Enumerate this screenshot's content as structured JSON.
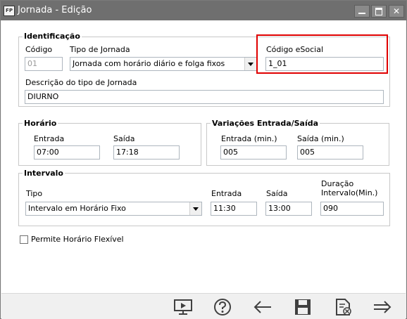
{
  "window": {
    "app_icon_text": "FP",
    "title": "Jornada - Edição",
    "close_symbol": "✕"
  },
  "identificacao": {
    "legend": "Identificação",
    "codigo_label": "Código",
    "codigo_value": "01",
    "tipo_label": "Tipo de Jornada",
    "tipo_value": "Jornada com horário diário e folga fixos",
    "esocial_label": "Código eSocial",
    "esocial_value": "1_01",
    "descricao_label": "Descrição do tipo de Jornada",
    "descricao_value": "DIURNO"
  },
  "horario": {
    "legend": "Horário",
    "entrada_label": "Entrada",
    "entrada_value": "07:00",
    "saida_label": "Saída",
    "saida_value": "17:18"
  },
  "variacoes": {
    "legend": "Variações Entrada/Saída",
    "entrada_label": "Entrada (min.)",
    "entrada_value": "005",
    "saida_label": "Saída (min.)",
    "saida_value": "005"
  },
  "intervalo": {
    "legend": "Intervalo",
    "tipo_label": "Tipo",
    "tipo_value": "Intervalo em Horário Fixo",
    "entrada_label": "Entrada",
    "entrada_value": "11:30",
    "saida_label": "Saída",
    "saida_value": "13:00",
    "duracao_label_1": "Duração",
    "duracao_label_2": "Intervalo(Min.)",
    "duracao_value": "090"
  },
  "flexivel": {
    "label": "Permite Horário Flexível",
    "checked": false
  },
  "toolbar": {
    "icons": [
      "presentation-icon",
      "help-icon",
      "back-arrow-icon",
      "save-icon",
      "delete-document-icon",
      "forward-arrow-icon"
    ]
  },
  "colors": {
    "titlebar": "#6f6f6f",
    "highlight": "#e00000",
    "icon": "#404040"
  }
}
